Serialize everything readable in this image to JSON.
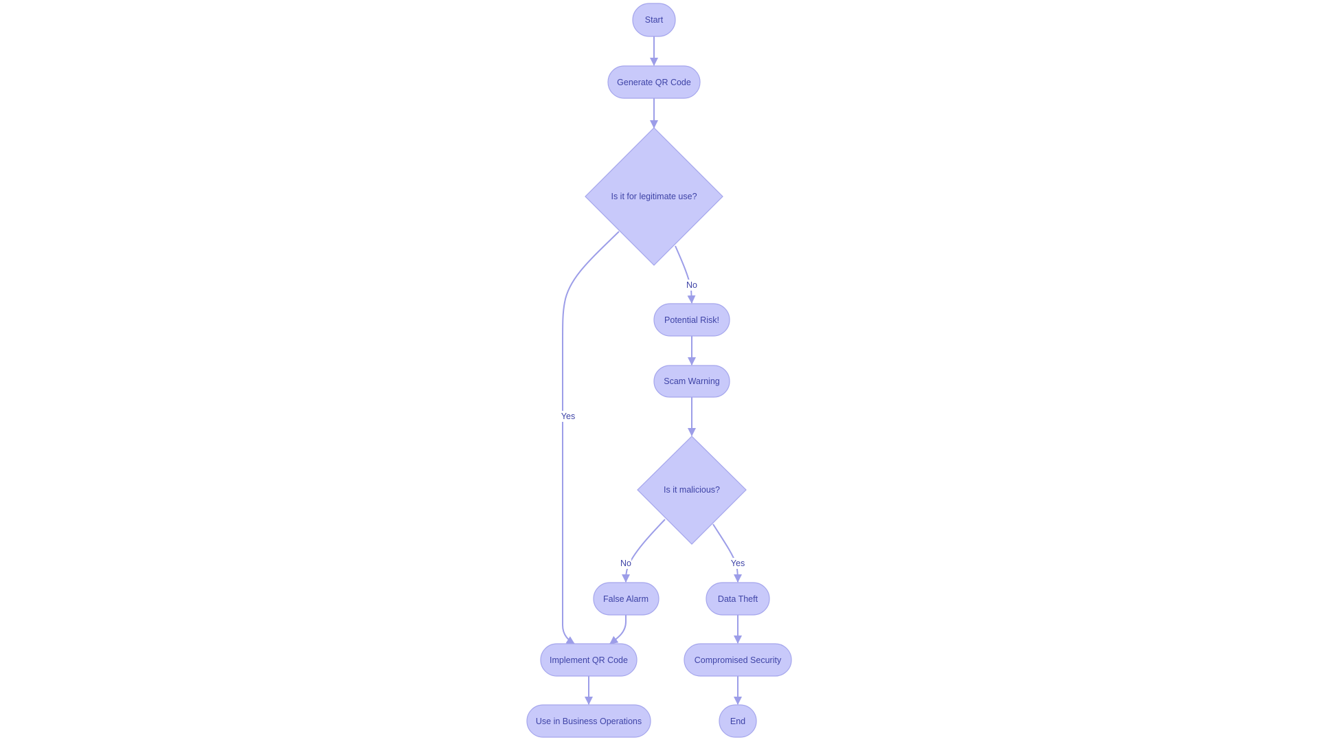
{
  "diagram": {
    "type": "flowchart",
    "direction": "top-down",
    "colors": {
      "node_fill": "#c8c9fa",
      "node_stroke": "#a4a5ec",
      "edge": "#9c9de8",
      "text": "#3e43a6",
      "background": "#ffffff"
    },
    "nodes": {
      "start": {
        "label": "Start",
        "shape": "stadium"
      },
      "generate": {
        "label": "Generate QR Code",
        "shape": "stadium"
      },
      "legit": {
        "label": "Is it for legitimate use?",
        "shape": "diamond"
      },
      "risk": {
        "label": "Potential Risk!",
        "shape": "stadium"
      },
      "scam": {
        "label": "Scam Warning",
        "shape": "stadium"
      },
      "malicious": {
        "label": "Is it malicious?",
        "shape": "diamond"
      },
      "false_alarm": {
        "label": "False Alarm",
        "shape": "stadium"
      },
      "data_theft": {
        "label": "Data Theft",
        "shape": "stadium"
      },
      "implement": {
        "label": "Implement QR Code",
        "shape": "stadium"
      },
      "compromised": {
        "label": "Compromised Security",
        "shape": "stadium"
      },
      "business": {
        "label": "Use in Business Operations",
        "shape": "stadium"
      },
      "end": {
        "label": "End",
        "shape": "stadium"
      }
    },
    "edges": [
      {
        "from": "start",
        "to": "generate",
        "label": ""
      },
      {
        "from": "generate",
        "to": "legit",
        "label": ""
      },
      {
        "from": "legit",
        "to": "implement",
        "label": "Yes"
      },
      {
        "from": "legit",
        "to": "risk",
        "label": "No"
      },
      {
        "from": "risk",
        "to": "scam",
        "label": ""
      },
      {
        "from": "scam",
        "to": "malicious",
        "label": ""
      },
      {
        "from": "malicious",
        "to": "false_alarm",
        "label": "No"
      },
      {
        "from": "malicious",
        "to": "data_theft",
        "label": "Yes"
      },
      {
        "from": "false_alarm",
        "to": "implement",
        "label": ""
      },
      {
        "from": "data_theft",
        "to": "compromised",
        "label": ""
      },
      {
        "from": "implement",
        "to": "business",
        "label": ""
      },
      {
        "from": "compromised",
        "to": "end",
        "label": ""
      }
    ],
    "edge_labels": {
      "legit_yes": "Yes",
      "legit_no": "No",
      "malicious_no": "No",
      "malicious_yes": "Yes"
    }
  }
}
